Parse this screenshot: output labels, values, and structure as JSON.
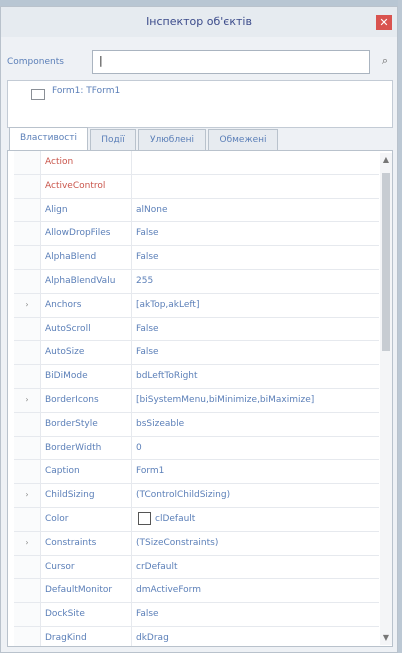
{
  "window": {
    "title": "Інспектор об'єктів",
    "close_glyph": "✕"
  },
  "components": {
    "label": "Components",
    "value": "|",
    "filter_icon": "filter-icon",
    "filter_glyph": "⌕"
  },
  "tree": {
    "item_label": "Form1: TForm1"
  },
  "tabs": [
    {
      "label": "Властивості",
      "active": true
    },
    {
      "label": "Події",
      "active": false
    },
    {
      "label": "Улюблені",
      "active": false
    },
    {
      "label": "Обмежені",
      "active": false
    }
  ],
  "properties": [
    {
      "name": "Action",
      "value": "",
      "special": true
    },
    {
      "name": "ActiveControl",
      "value": "",
      "special": true
    },
    {
      "name": "Align",
      "value": "alNone"
    },
    {
      "name": "AllowDropFiles",
      "value": "False"
    },
    {
      "name": "AlphaBlend",
      "value": "False"
    },
    {
      "name": "AlphaBlendValu",
      "value": "255"
    },
    {
      "name": "Anchors",
      "value": "[akTop,akLeft]",
      "expand": true
    },
    {
      "name": "AutoScroll",
      "value": "False"
    },
    {
      "name": "AutoSize",
      "value": "False"
    },
    {
      "name": "BiDiMode",
      "value": "bdLeftToRight"
    },
    {
      "name": "BorderIcons",
      "value": "[biSystemMenu,biMinimize,biMaximize]",
      "expand": true
    },
    {
      "name": "BorderStyle",
      "value": "bsSizeable"
    },
    {
      "name": "BorderWidth",
      "value": "0"
    },
    {
      "name": "Caption",
      "value": "Form1"
    },
    {
      "name": "ChildSizing",
      "value": "(TControlChildSizing)",
      "expand": true
    },
    {
      "name": "Color",
      "value": "clDefault",
      "swatch": "#ffffff"
    },
    {
      "name": "Constraints",
      "value": "(TSizeConstraints)",
      "expand": true
    },
    {
      "name": "Cursor",
      "value": "crDefault"
    },
    {
      "name": "DefaultMonitor",
      "value": "dmActiveForm"
    },
    {
      "name": "DockSite",
      "value": "False"
    },
    {
      "name": "DragKind",
      "value": "dkDrag"
    }
  ],
  "expand_glyph": "›",
  "scroll": {
    "up_glyph": "▲",
    "down_glyph": "▼"
  }
}
